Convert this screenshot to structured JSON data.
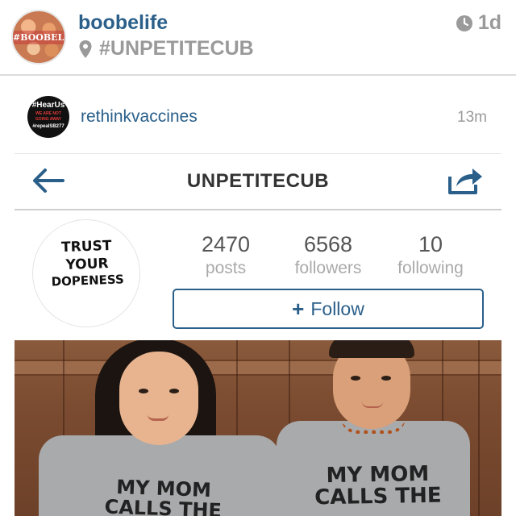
{
  "outer_post": {
    "username": "boobelife",
    "avatar_text": "#BOOBELIFE",
    "location": "#UNPETITECUB",
    "time": "1d",
    "icons": {
      "location": "pin-icon",
      "time": "clock-icon"
    }
  },
  "embedded": {
    "username": "rethinkvaccines",
    "time": "13m",
    "avatar_lines": [
      "#HearUs",
      "WE ARE NOT",
      "GOING AWAY",
      "#repealSB277"
    ],
    "profile": {
      "title": "UNPETITECUB",
      "avatar_lines": [
        "TRUST",
        "YOUR",
        "DOPENESS"
      ],
      "stats": [
        {
          "value": "2470",
          "label": "posts"
        },
        {
          "value": "6568",
          "label": "followers"
        },
        {
          "value": "10",
          "label": "following"
        }
      ],
      "follow_plus": "+",
      "follow_label": "Follow"
    },
    "photo": {
      "shirt_text_left": [
        "MY MOM",
        "CALLS THE"
      ],
      "shirt_text_right": [
        "MY MOM",
        "CALLS THE"
      ]
    }
  },
  "colors": {
    "link_blue": "#2a5f8a",
    "muted_gray": "#9a9a9a",
    "title_dark": "#333333"
  }
}
